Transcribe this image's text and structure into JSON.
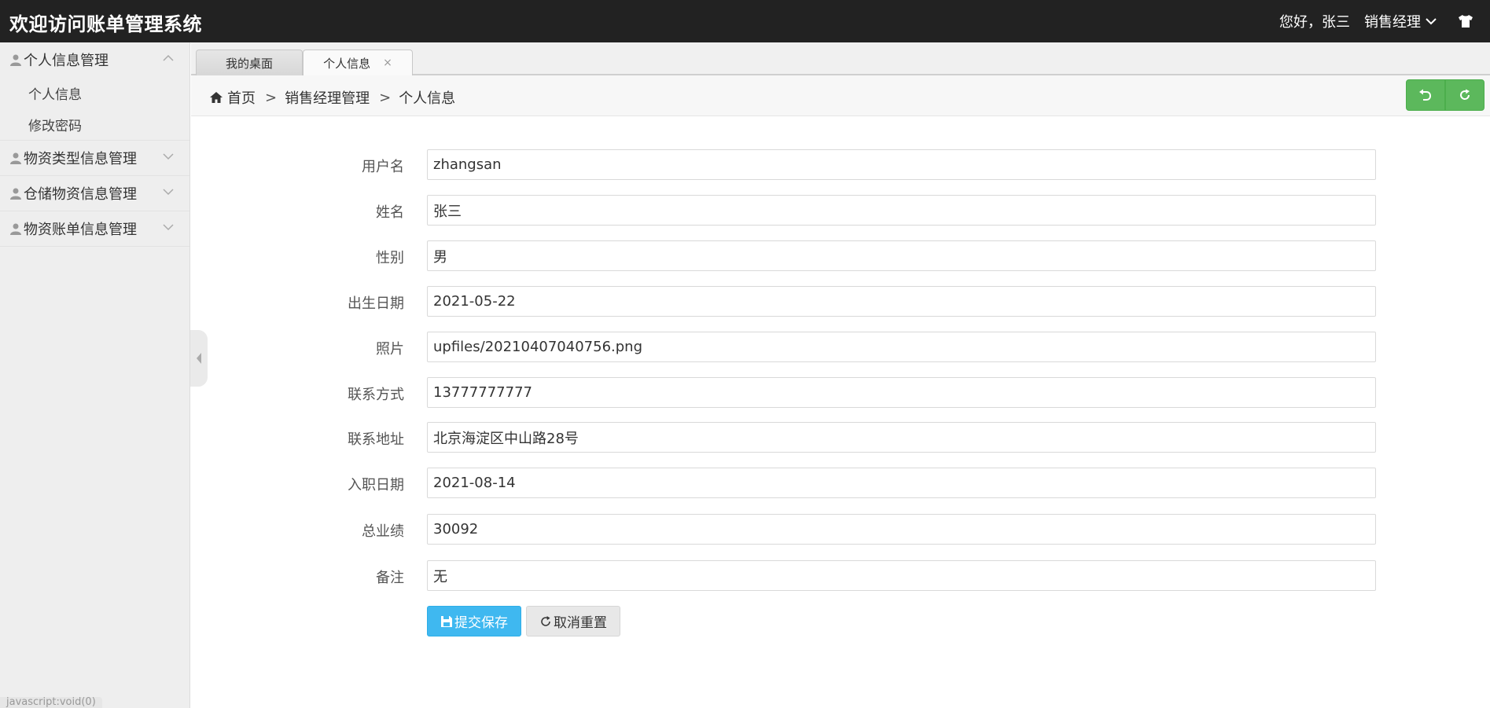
{
  "header": {
    "app_title": "欢迎访问账单管理系统",
    "greeting": "您好，张三",
    "role": "销售经理",
    "theme_icon": "tshirt-icon"
  },
  "sidebar": {
    "groups": [
      {
        "label": "个人信息管理",
        "expanded": true,
        "items": [
          "个人信息",
          "修改密码"
        ]
      },
      {
        "label": "物资类型信息管理",
        "expanded": false
      },
      {
        "label": "仓储物资信息管理",
        "expanded": false
      },
      {
        "label": "物资账单信息管理",
        "expanded": false
      }
    ],
    "status_hint": "javascript:void(0)"
  },
  "tabs": [
    {
      "label": "我的桌面",
      "active": false
    },
    {
      "label": "个人信息",
      "active": true,
      "close": "×"
    }
  ],
  "breadcrumb": {
    "home": "首页",
    "sep": ">",
    "level1": "销售经理管理",
    "level2": "个人信息"
  },
  "form": {
    "fields": [
      {
        "label": "用户名",
        "value": "zhangsan"
      },
      {
        "label": "姓名",
        "value": "张三"
      },
      {
        "label": "性别",
        "value": "男"
      },
      {
        "label": "出生日期",
        "value": "2021-05-22"
      },
      {
        "label": "照片",
        "value": "upfiles/20210407040756.png"
      },
      {
        "label": "联系方式",
        "value": "13777777777"
      },
      {
        "label": "联系地址",
        "value": "北京海淀区中山路28号"
      },
      {
        "label": "入职日期",
        "value": "2021-08-14"
      },
      {
        "label": "总业绩",
        "value": "30092"
      },
      {
        "label": "备注",
        "value": "无"
      }
    ],
    "submit_label": "提交保存",
    "reset_label": "取消重置"
  },
  "colors": {
    "header_bg": "#222222",
    "sidebar_bg": "#eeeeee",
    "success": "#5cb85c",
    "primary": "#3fb8f0"
  }
}
